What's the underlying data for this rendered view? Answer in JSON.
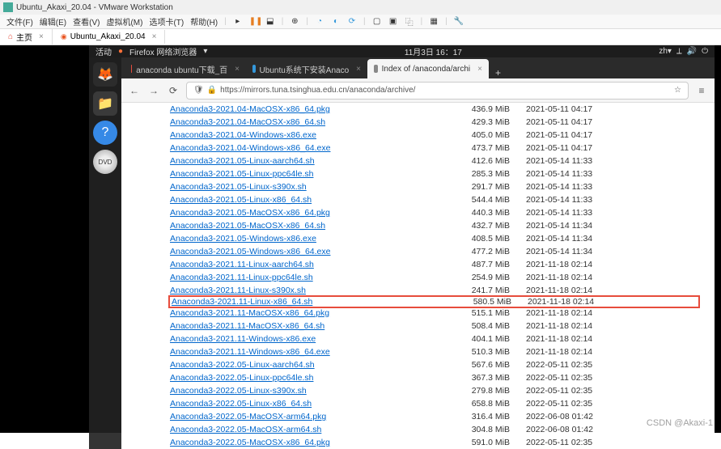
{
  "vm": {
    "title": "Ubuntu_Akaxi_20.04 - VMware Workstation",
    "menu": [
      "文件(F)",
      "编辑(E)",
      "查看(V)",
      "虚拟机(M)",
      "选项卡(T)",
      "帮助(H)"
    ],
    "tabs": {
      "home": "主页",
      "vm_tab": "Ubuntu_Akaxi_20.04"
    }
  },
  "ubuntu": {
    "activities": "活动",
    "app": "Firefox 网络浏览器",
    "datetime": "11月3日 16：17"
  },
  "browser": {
    "tabs": [
      {
        "label": "anaconda ubuntu下载_百",
        "active": false
      },
      {
        "label": "Ubuntu系统下安装Anaco",
        "active": false
      },
      {
        "label": "Index of /anaconda/archi",
        "active": true
      }
    ],
    "url_display": "https://mirrors.tuna.tsinghua.edu.cn/anaconda/archive/",
    "url_highlight": "tsinghua.edu.cn"
  },
  "listing": [
    {
      "name": "Anaconda3-2021.04-MacOSX-x86_64.pkg",
      "size": "436.9 MiB",
      "date": "2021-05-11 04:17"
    },
    {
      "name": "Anaconda3-2021.04-MacOSX-x86_64.sh",
      "size": "429.3 MiB",
      "date": "2021-05-11 04:17"
    },
    {
      "name": "Anaconda3-2021.04-Windows-x86.exe",
      "size": "405.0 MiB",
      "date": "2021-05-11 04:17"
    },
    {
      "name": "Anaconda3-2021.04-Windows-x86_64.exe",
      "size": "473.7 MiB",
      "date": "2021-05-11 04:17"
    },
    {
      "name": "Anaconda3-2021.05-Linux-aarch64.sh",
      "size": "412.6 MiB",
      "date": "2021-05-14 11:33"
    },
    {
      "name": "Anaconda3-2021.05-Linux-ppc64le.sh",
      "size": "285.3 MiB",
      "date": "2021-05-14 11:33"
    },
    {
      "name": "Anaconda3-2021.05-Linux-s390x.sh",
      "size": "291.7 MiB",
      "date": "2021-05-14 11:33"
    },
    {
      "name": "Anaconda3-2021.05-Linux-x86_64.sh",
      "size": "544.4 MiB",
      "date": "2021-05-14 11:33"
    },
    {
      "name": "Anaconda3-2021.05-MacOSX-x86_64.pkg",
      "size": "440.3 MiB",
      "date": "2021-05-14 11:33"
    },
    {
      "name": "Anaconda3-2021.05-MacOSX-x86_64.sh",
      "size": "432.7 MiB",
      "date": "2021-05-14 11:34"
    },
    {
      "name": "Anaconda3-2021.05-Windows-x86.exe",
      "size": "408.5 MiB",
      "date": "2021-05-14 11:34"
    },
    {
      "name": "Anaconda3-2021.05-Windows-x86_64.exe",
      "size": "477.2 MiB",
      "date": "2021-05-14 11:34"
    },
    {
      "name": "Anaconda3-2021.11-Linux-aarch64.sh",
      "size": "487.7 MiB",
      "date": "2021-11-18 02:14"
    },
    {
      "name": "Anaconda3-2021.11-Linux-ppc64le.sh",
      "size": "254.9 MiB",
      "date": "2021-11-18 02:14"
    },
    {
      "name": "Anaconda3-2021.11-Linux-s390x.sh",
      "size": "241.7 MiB",
      "date": "2021-11-18 02:14"
    },
    {
      "name": "Anaconda3-2021.11-Linux-x86_64.sh",
      "size": "580.5 MiB",
      "date": "2021-11-18 02:14",
      "highlighted": true
    },
    {
      "name": "Anaconda3-2021.11-MacOSX-x86_64.pkg",
      "size": "515.1 MiB",
      "date": "2021-11-18 02:14"
    },
    {
      "name": "Anaconda3-2021.11-MacOSX-x86_64.sh",
      "size": "508.4 MiB",
      "date": "2021-11-18 02:14"
    },
    {
      "name": "Anaconda3-2021.11-Windows-x86.exe",
      "size": "404.1 MiB",
      "date": "2021-11-18 02:14"
    },
    {
      "name": "Anaconda3-2021.11-Windows-x86_64.exe",
      "size": "510.3 MiB",
      "date": "2021-11-18 02:14"
    },
    {
      "name": "Anaconda3-2022.05-Linux-aarch64.sh",
      "size": "567.6 MiB",
      "date": "2022-05-11 02:35"
    },
    {
      "name": "Anaconda3-2022.05-Linux-ppc64le.sh",
      "size": "367.3 MiB",
      "date": "2022-05-11 02:35"
    },
    {
      "name": "Anaconda3-2022.05-Linux-s390x.sh",
      "size": "279.8 MiB",
      "date": "2022-05-11 02:35"
    },
    {
      "name": "Anaconda3-2022.05-Linux-x86_64.sh",
      "size": "658.8 MiB",
      "date": "2022-05-11 02:35"
    },
    {
      "name": "Anaconda3-2022.05-MacOSX-arm64.pkg",
      "size": "316.4 MiB",
      "date": "2022-06-08 01:42"
    },
    {
      "name": "Anaconda3-2022.05-MacOSX-arm64.sh",
      "size": "304.8 MiB",
      "date": "2022-06-08 01:42"
    },
    {
      "name": "Anaconda3-2022.05-MacOSX-x86_64.pkg",
      "size": "591.0 MiB",
      "date": "2022-05-11 02:35"
    }
  ],
  "watermark": "CSDN @Akaxi-1"
}
